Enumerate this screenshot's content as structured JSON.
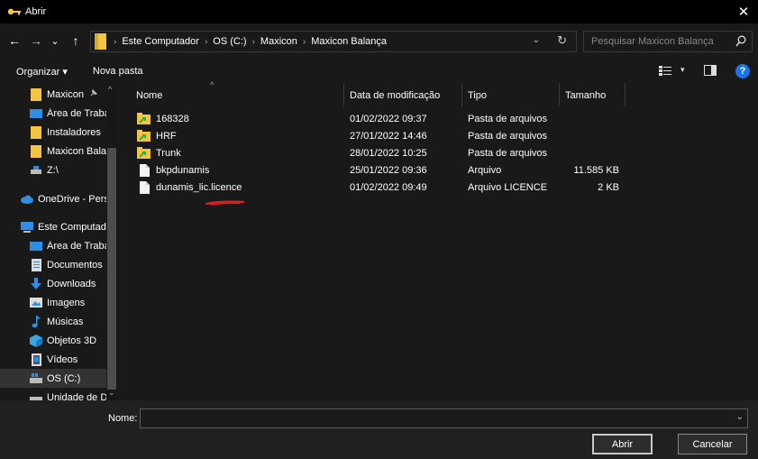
{
  "window": {
    "title": "Abrir",
    "close_glyph": "✕"
  },
  "nav": {
    "back_glyph": "←",
    "forward_glyph": "→",
    "recent_glyph": "⌄",
    "up_glyph": "↑"
  },
  "address": {
    "breadcrumbs": [
      "Este Computador",
      "OS (C:)",
      "Maxicon",
      "Maxicon Balança"
    ],
    "separator": "›",
    "refresh_glyph": "↻",
    "dropdown_glyph": "⌄"
  },
  "search": {
    "placeholder": "Pesquisar Maxicon Balança"
  },
  "toolbar": {
    "organize_label": "Organizar ▾",
    "new_folder_label": "Nova pasta",
    "help_label": "?",
    "view_dropdown_glyph": "▾"
  },
  "sidebar": {
    "pin_glyph": "📌",
    "items": [
      {
        "label": "Maxicon",
        "icon": "folder-icon",
        "pinned": true
      },
      {
        "label": "Área de Trabal",
        "icon": "desktop-icon"
      },
      {
        "label": "Instaladores",
        "icon": "folder-icon"
      },
      {
        "label": "Maxicon Balar",
        "icon": "folder-icon"
      },
      {
        "label": "Z:\\",
        "icon": "network-drive-icon"
      },
      {
        "label": "OneDrive - Pers",
        "icon": "cloud-icon"
      },
      {
        "label": "Este Computad",
        "icon": "computer-icon"
      },
      {
        "label": "Área de Trabal",
        "icon": "desktop-icon"
      },
      {
        "label": "Documentos",
        "icon": "documents-icon"
      },
      {
        "label": "Downloads",
        "icon": "download-icon"
      },
      {
        "label": "Imagens",
        "icon": "pictures-icon"
      },
      {
        "label": "Músicas",
        "icon": "music-icon"
      },
      {
        "label": "Objetos 3D",
        "icon": "cube-icon"
      },
      {
        "label": "Vídeos",
        "icon": "video-icon"
      },
      {
        "label": "OS (C:)",
        "icon": "drive-icon",
        "selected": true
      },
      {
        "label": "Unidade de D",
        "icon": "drive-icon"
      }
    ]
  },
  "columns": {
    "name": "Nome",
    "modified": "Data de modificação",
    "type": "Tipo",
    "size": "Tamanho"
  },
  "files": [
    {
      "name": "168328",
      "modified": "01/02/2022 09:37",
      "type": "Pasta de arquivos",
      "size": "",
      "icon": "shortcut-folder-icon"
    },
    {
      "name": "HRF",
      "modified": "27/01/2022 14:46",
      "type": "Pasta de arquivos",
      "size": "",
      "icon": "shortcut-folder-icon"
    },
    {
      "name": "Trunk",
      "modified": "28/01/2022 10:25",
      "type": "Pasta de arquivos",
      "size": "",
      "icon": "shortcut-folder-icon"
    },
    {
      "name": "bkpdunamis",
      "modified": "25/01/2022 09:36",
      "type": "Arquivo",
      "size": "11.585 KB",
      "icon": "file-icon"
    },
    {
      "name": "dunamis_lic.licence",
      "modified": "01/02/2022 09:49",
      "type": "Arquivo LICENCE",
      "size": "2 KB",
      "icon": "file-icon"
    }
  ],
  "bottom": {
    "filename_label": "Nome:",
    "filename_value": "",
    "open_label": "Abrir",
    "cancel_label": "Cancelar"
  },
  "colors": {
    "folder": "#f4c542",
    "accent": "#1a73e8",
    "annotation": "#e02020"
  }
}
